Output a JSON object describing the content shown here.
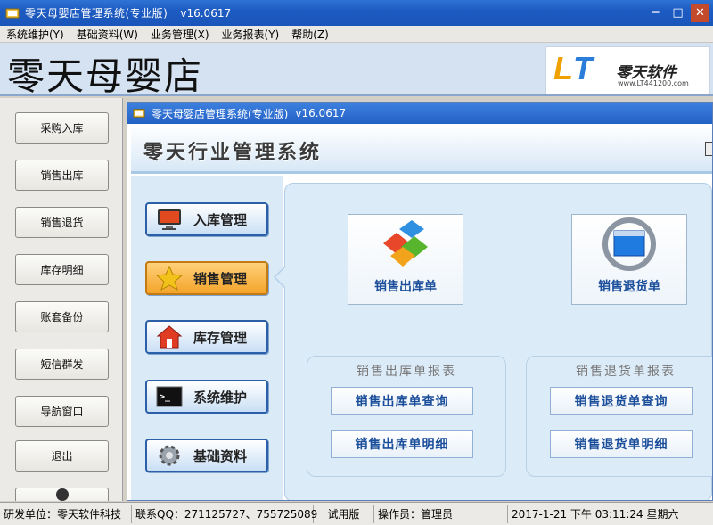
{
  "window": {
    "title": "零天母婴店管理系统(专业版)",
    "version": "v16.0617",
    "minimize_glyph": "━",
    "restore_glyph": "□",
    "close_glyph": "✕"
  },
  "menu": [
    {
      "label": "系统维护(Y)"
    },
    {
      "label": "基础资料(W)"
    },
    {
      "label": "业务管理(X)"
    },
    {
      "label": "业务报表(Y)"
    },
    {
      "label": "帮助(Z)"
    }
  ],
  "brand": {
    "store_name": "零天母婴店",
    "logo_mark_a": "L",
    "logo_mark_b": "T",
    "logo_name": "零天软件",
    "logo_url": "www.LT441200.com"
  },
  "sidebar": {
    "buttons": [
      {
        "label": "采购入库"
      },
      {
        "label": "销售出库"
      },
      {
        "label": "销售退货"
      },
      {
        "label": "库存明细"
      },
      {
        "label": "账套备份"
      },
      {
        "label": "短信群发"
      },
      {
        "label": "导航窗口"
      },
      {
        "label": "退出"
      }
    ]
  },
  "inner_window": {
    "title": "零天母婴店管理系统(专业版)",
    "version": "v16.0617",
    "header_title": "零天行业管理系统"
  },
  "nav": {
    "items": [
      {
        "label": "入库管理",
        "icon": "monitor-icon"
      },
      {
        "label": "销售管理",
        "icon": "star-icon",
        "active": true
      },
      {
        "label": "库存管理",
        "icon": "house-icon"
      },
      {
        "label": "系统维护",
        "icon": "terminal-icon"
      },
      {
        "label": "基础资料",
        "icon": "gear-icon"
      }
    ]
  },
  "main": {
    "big_buttons": [
      {
        "label": "销售出库单",
        "icon": "cube-puzzle-icon"
      },
      {
        "label": "销售退货单",
        "icon": "refresh-window-icon"
      }
    ],
    "groups": [
      {
        "title": "销售出库单报表",
        "buttons": [
          {
            "label": "销售出库单查询"
          },
          {
            "label": "销售出库单明细"
          }
        ]
      },
      {
        "title": "销售退货单报表",
        "buttons": [
          {
            "label": "销售退货单查询"
          },
          {
            "label": "销售退货单明细"
          }
        ]
      }
    ]
  },
  "status": {
    "developer": "研发单位：零天软件科技",
    "qq": "联系QQ：271125727、755725089",
    "edition": "试用版",
    "operator": "操作员：管理员",
    "datetime": "2017-1-21  下午 03:11:24  星期六"
  },
  "colors": {
    "titlebar": "#1d5bc2",
    "active_nav": "#f4a42a",
    "accent_text": "#1a4d9a"
  }
}
